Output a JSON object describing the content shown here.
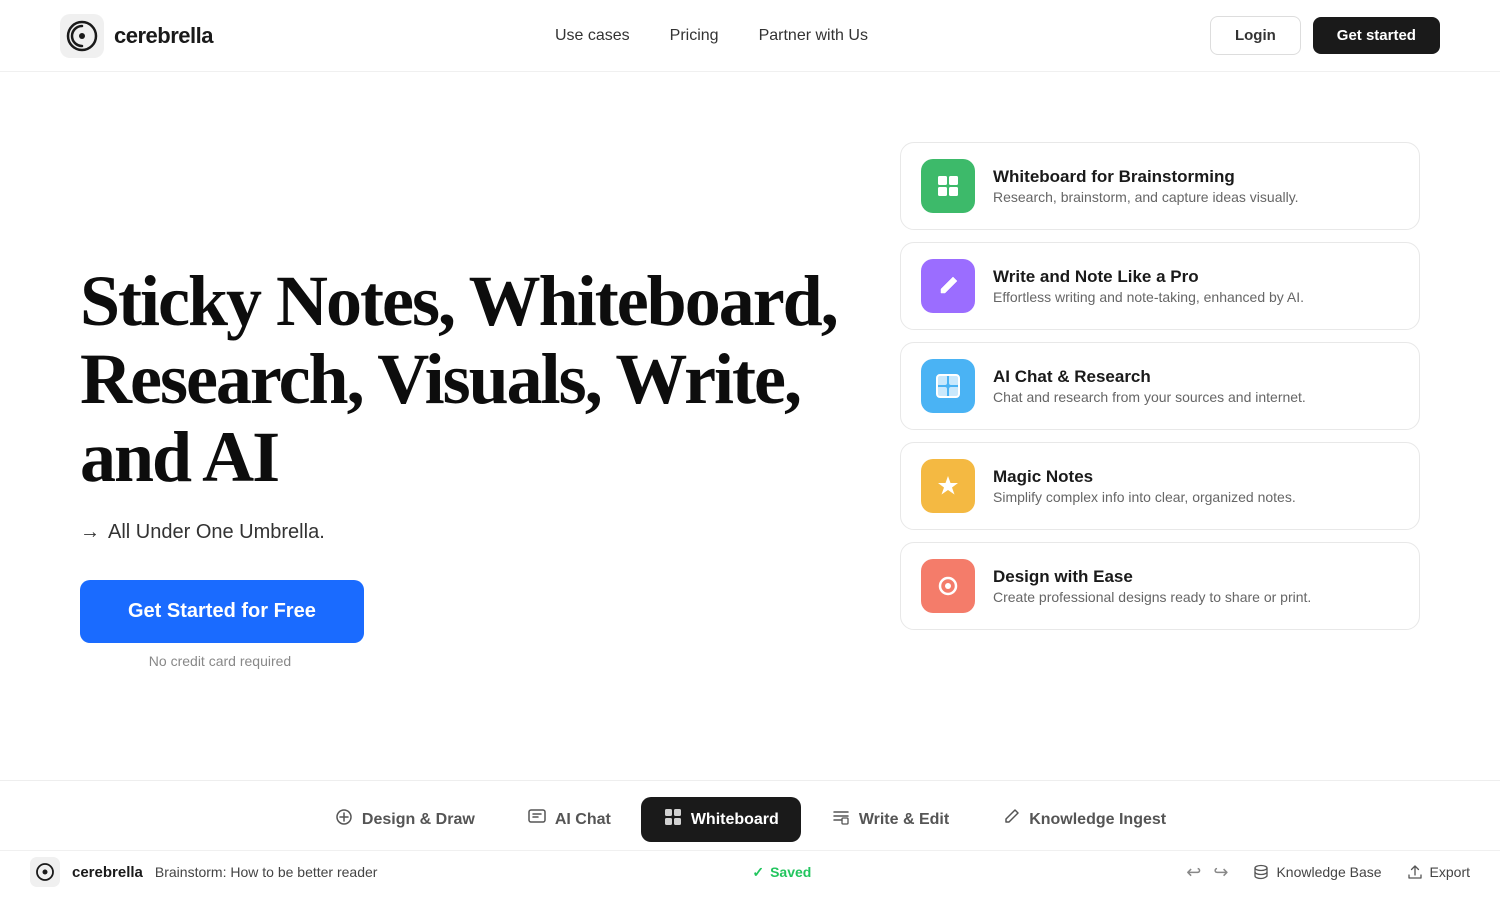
{
  "navbar": {
    "logo_text": "cerebrella",
    "links": [
      {
        "label": "Use cases",
        "id": "use-cases"
      },
      {
        "label": "Pricing",
        "id": "pricing"
      },
      {
        "label": "Partner with Us",
        "id": "partner"
      }
    ],
    "login_label": "Login",
    "get_started_label": "Get started"
  },
  "hero": {
    "title": "Sticky Notes, Whiteboard, Research, Visuals, Write, and AI",
    "subtitle": "All Under One Umbrella.",
    "arrow": "→",
    "cta_label": "Get Started for Free",
    "no_credit": "No credit card required"
  },
  "features": [
    {
      "id": "whiteboard",
      "color": "green",
      "icon": "▦",
      "title": "Whiteboard for Brainstorming",
      "desc": "Research, brainstorm, and capture ideas visually."
    },
    {
      "id": "write",
      "color": "purple",
      "icon": "✏",
      "title": "Write and Note Like a Pro",
      "desc": "Effortless writing and note-taking, enhanced by AI."
    },
    {
      "id": "ai-chat",
      "color": "blue",
      "icon": "⧉",
      "title": "AI Chat & Research",
      "desc": "Chat and research from your sources and internet."
    },
    {
      "id": "magic-notes",
      "color": "orange",
      "icon": "⚡",
      "title": "Magic Notes",
      "desc": "Simplify complex info into clear, organized notes."
    },
    {
      "id": "design",
      "color": "red",
      "icon": "◎",
      "title": "Design with Ease",
      "desc": "Create professional designs ready to share or print."
    }
  ],
  "tabs": [
    {
      "id": "design-draw",
      "label": "Design & Draw",
      "icon": "🎨",
      "active": false
    },
    {
      "id": "ai-chat",
      "label": "AI Chat",
      "icon": "📖",
      "active": false
    },
    {
      "id": "whiteboard",
      "label": "Whiteboard",
      "icon": "🗒",
      "active": true
    },
    {
      "id": "write-edit",
      "label": "Write & Edit",
      "icon": "≡",
      "active": false
    },
    {
      "id": "knowledge-ingest",
      "label": "Knowledge Ingest",
      "icon": "✍",
      "active": false
    }
  ],
  "appbar": {
    "logo": "cerebrella",
    "doc_title": "Brainstorm: How to be better reader",
    "saved_label": "Saved",
    "undo_label": "↩",
    "redo_label": "↪",
    "knowledge_base_label": "Knowledge Base",
    "export_label": "Export"
  }
}
